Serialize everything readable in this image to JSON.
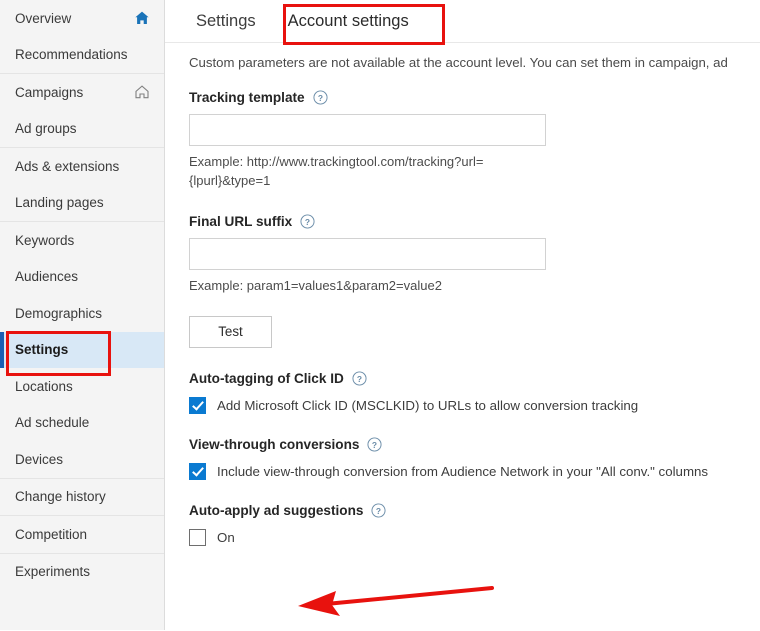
{
  "sidebar": {
    "groups": [
      {
        "items": [
          {
            "label": "Overview",
            "icon": "home-filled-icon",
            "selected": false
          },
          {
            "label": "Recommendations",
            "icon": "",
            "selected": false
          }
        ]
      },
      {
        "items": [
          {
            "label": "Campaigns",
            "icon": "home-outline-icon",
            "selected": false
          },
          {
            "label": "Ad groups",
            "icon": "",
            "selected": false
          }
        ]
      },
      {
        "items": [
          {
            "label": "Ads & extensions",
            "icon": "",
            "selected": false
          },
          {
            "label": "Landing pages",
            "icon": "",
            "selected": false
          }
        ]
      },
      {
        "items": [
          {
            "label": "Keywords",
            "icon": "",
            "selected": false
          },
          {
            "label": "Audiences",
            "icon": "",
            "selected": false
          },
          {
            "label": "Demographics",
            "icon": "",
            "selected": false
          },
          {
            "label": "Settings",
            "icon": "",
            "selected": true
          },
          {
            "label": "Locations",
            "icon": "",
            "selected": false
          },
          {
            "label": "Ad schedule",
            "icon": "",
            "selected": false
          },
          {
            "label": "Devices",
            "icon": "",
            "selected": false
          }
        ]
      },
      {
        "items": [
          {
            "label": "Change history",
            "icon": "",
            "selected": false
          }
        ]
      },
      {
        "items": [
          {
            "label": "Competition",
            "icon": "",
            "selected": false
          }
        ]
      },
      {
        "items": [
          {
            "label": "Experiments",
            "icon": "",
            "selected": false
          }
        ]
      }
    ]
  },
  "main": {
    "tabs": [
      {
        "label": "Settings",
        "active": false
      },
      {
        "label": "Account settings",
        "active": true
      }
    ],
    "description": "Custom parameters are not available at the account level. You can set them in campaign, ad",
    "tracking_template": {
      "label": "Tracking template",
      "help_icon": "help-circle-icon",
      "value": "",
      "placeholder": "",
      "example": "Example: http://www.trackingtool.com/tracking?url={lpurl}&type=1"
    },
    "final_url_suffix": {
      "label": "Final URL suffix",
      "help_icon": "help-circle-icon",
      "value": "",
      "placeholder": "",
      "example": "Example: param1=values1&param2=value2"
    },
    "test_button_label": "Test",
    "auto_tagging": {
      "label": "Auto-tagging of Click ID",
      "help_icon": "help-circle-icon",
      "checkbox_label": "Add Microsoft Click ID (MSCLKID) to URLs to allow conversion tracking",
      "checked": true
    },
    "view_through": {
      "label": "View-through conversions",
      "help_icon": "help-circle-icon",
      "checkbox_label": "Include view-through conversion from Audience Network in your \"All conv.\" columns",
      "checked": true
    },
    "auto_apply": {
      "label": "Auto-apply ad suggestions",
      "help_icon": "help-circle-icon",
      "checkbox_label": "On",
      "checked": false
    }
  },
  "annotations": {
    "color": "#e8120e",
    "settings_nav_box": "highlight-rectangle",
    "account_tab_box": "highlight-rectangle",
    "arrow": "pointer-arrow-left"
  },
  "colors": {
    "accent_blue": "#0a7ad1",
    "nav_selected_bg": "#d8e8f6",
    "nav_selected_bar": "#1a5fb4",
    "sidebar_bg": "#f4f4f4",
    "annotation_red": "#e8120e"
  }
}
